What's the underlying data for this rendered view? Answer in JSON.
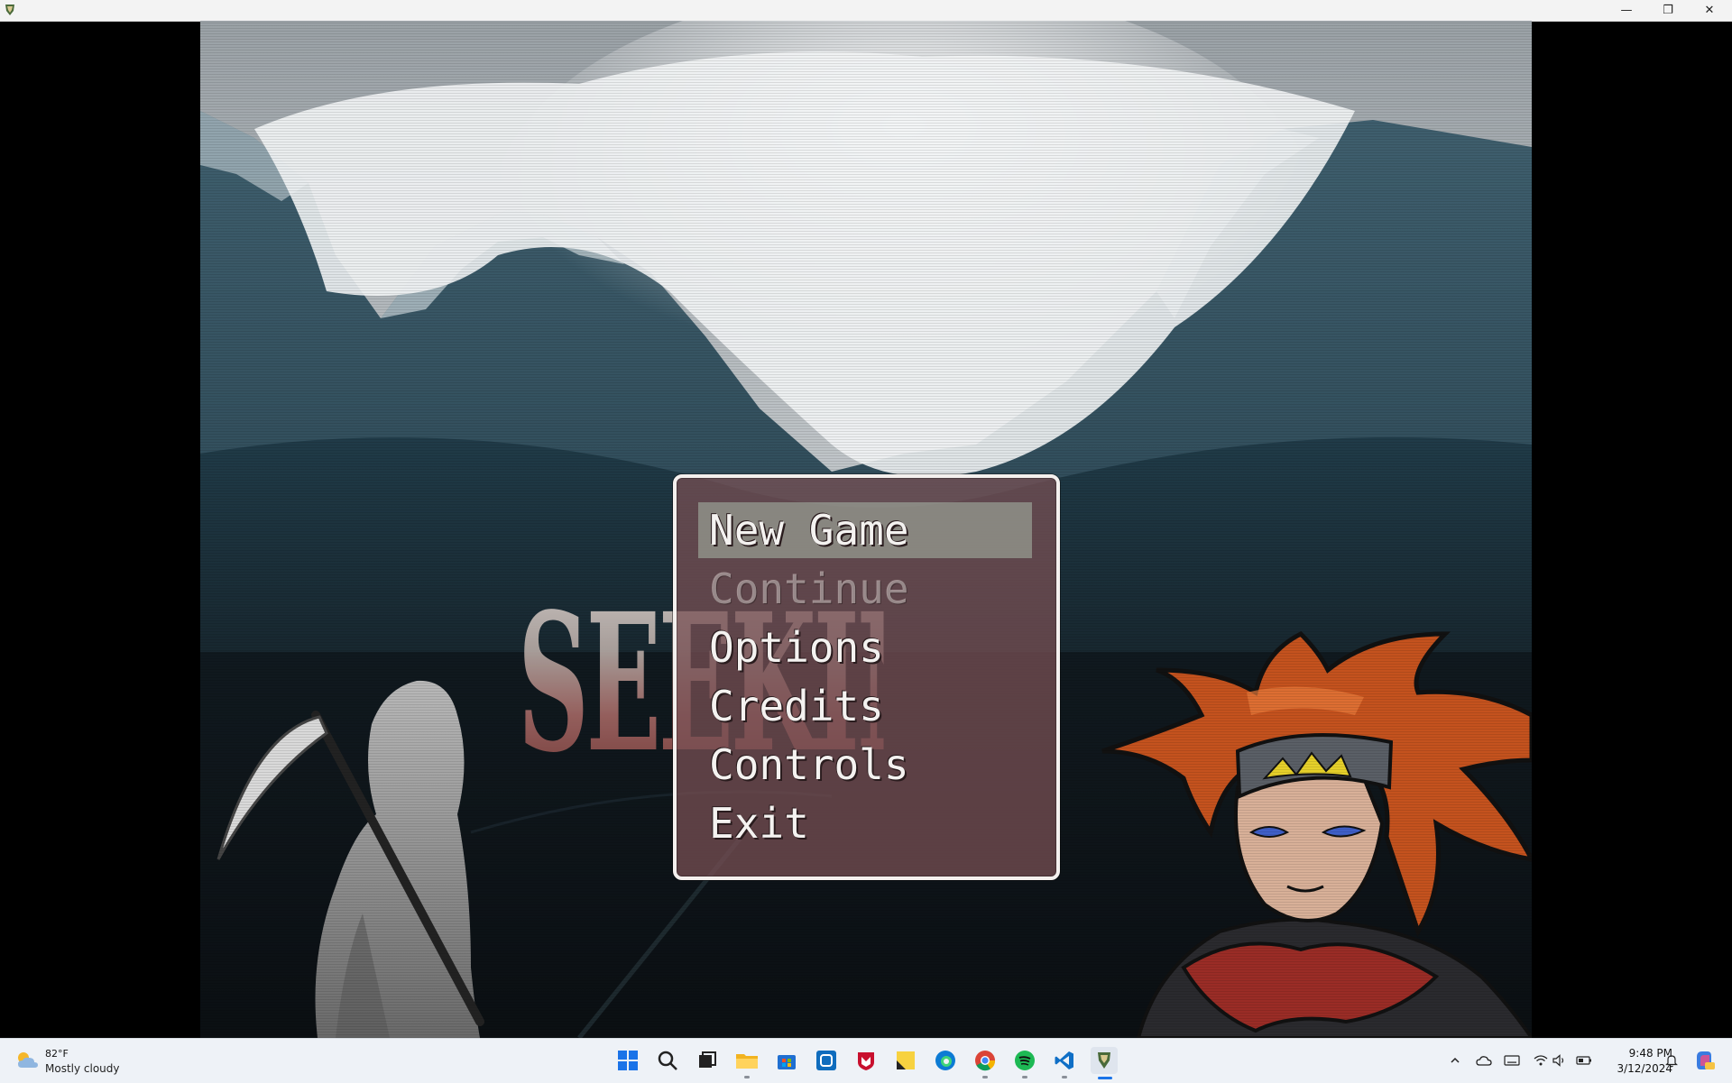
{
  "window": {
    "minimize_glyph": "—",
    "restore_glyph": "❐",
    "close_glyph": "✕"
  },
  "game": {
    "logo_text": "SEEKING WAY",
    "menu": {
      "items": [
        {
          "label": "New Game",
          "state": "selected"
        },
        {
          "label": "Continue",
          "state": "disabled"
        },
        {
          "label": "Options",
          "state": "normal"
        },
        {
          "label": "Credits",
          "state": "normal"
        },
        {
          "label": "Controls",
          "state": "normal"
        },
        {
          "label": "Exit",
          "state": "normal"
        }
      ]
    }
  },
  "taskbar": {
    "weather": {
      "temp": "82°F",
      "desc": "Mostly cloudy",
      "icon": "partly-cloudy-icon"
    },
    "apps": [
      {
        "name": "start-icon"
      },
      {
        "name": "search-icon"
      },
      {
        "name": "task-view-icon"
      },
      {
        "name": "file-explorer-icon"
      },
      {
        "name": "microsoft-store-icon"
      },
      {
        "name": "app-icon"
      },
      {
        "name": "mcafee-icon"
      },
      {
        "name": "sticky-notes-icon"
      },
      {
        "name": "edge-icon"
      },
      {
        "name": "chrome-icon"
      },
      {
        "name": "spotify-icon"
      },
      {
        "name": "vscode-icon"
      },
      {
        "name": "game-app-icon"
      }
    ],
    "clock": {
      "time": "9:48 PM",
      "date": "3/12/2024"
    }
  }
}
